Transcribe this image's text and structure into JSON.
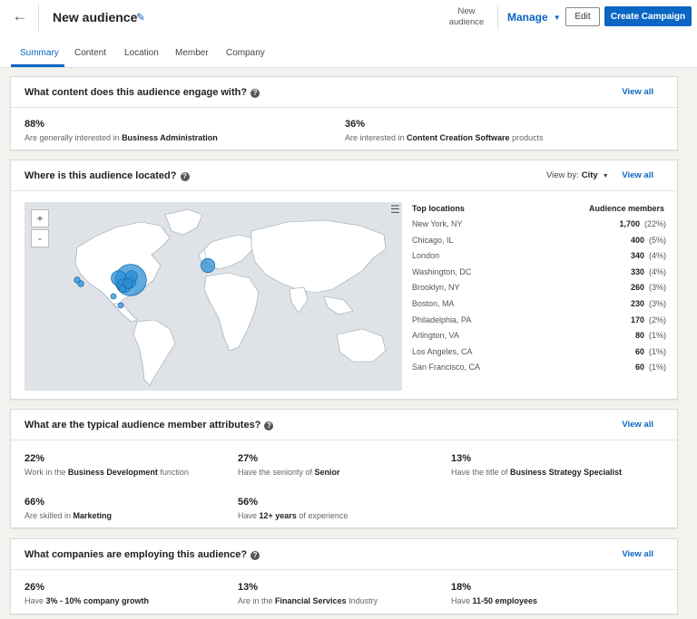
{
  "header": {
    "back_icon": "arrow-left-icon",
    "title": "New audience",
    "edit_icon": "pencil-icon",
    "name_line1": "New",
    "name_line2": "audience",
    "manage_label": "Manage",
    "edit_label": "Edit",
    "create_label": "Create Campaign"
  },
  "tabs": [
    {
      "label": "Summary",
      "active": true
    },
    {
      "label": "Content"
    },
    {
      "label": "Location"
    },
    {
      "label": "Member"
    },
    {
      "label": "Company"
    }
  ],
  "content_card": {
    "title": "What content does this audience engage with?",
    "view_all": "View all",
    "stats": [
      {
        "pct": "88%",
        "pre": "Are generally interested in ",
        "bold": "Business Administration",
        "post": ""
      },
      {
        "pct": "36%",
        "pre": "Are interested in ",
        "bold": "Content Creation Software",
        "post": " products"
      }
    ]
  },
  "location_card": {
    "title": "Where is this audience located?",
    "view_by_label": "View by:",
    "view_by_value": "City",
    "view_all": "View all",
    "zoom_in": "+",
    "zoom_out": "-",
    "menu_icon": "hamburger-menu-icon",
    "col_locations": "Top locations",
    "col_members": "Audience members",
    "rows": [
      {
        "city": "New York, NY",
        "count": "1,700",
        "pct": "(22%)"
      },
      {
        "city": "Chicago, IL",
        "count": "400",
        "pct": "(5%)"
      },
      {
        "city": "London",
        "count": "340",
        "pct": "(4%)"
      },
      {
        "city": "Washington, DC",
        "count": "330",
        "pct": "(4%)"
      },
      {
        "city": "Brooklyn, NY",
        "count": "260",
        "pct": "(3%)"
      },
      {
        "city": "Boston, MA",
        "count": "230",
        "pct": "(3%)"
      },
      {
        "city": "Philadelphia, PA",
        "count": "170",
        "pct": "(2%)"
      },
      {
        "city": "Arlington, VA",
        "count": "80",
        "pct": "(1%)"
      },
      {
        "city": "Los Angeles, CA",
        "count": "60",
        "pct": "(1%)"
      },
      {
        "city": "San Francisco, CA",
        "count": "60",
        "pct": "(1%)"
      }
    ]
  },
  "attributes_card": {
    "title": "What are the typical audience member attributes?",
    "view_all": "View all",
    "stats": [
      {
        "pct": "22%",
        "pre": "Work in the ",
        "bold": "Business Development",
        "post": " function"
      },
      {
        "pct": "27%",
        "pre": "Have the seniority of ",
        "bold": "Senior",
        "post": ""
      },
      {
        "pct": "13%",
        "pre": "Have the title of ",
        "bold": "Business Strategy Specialist",
        "post": ""
      },
      {
        "pct": "66%",
        "pre": "Are skilled in ",
        "bold": "Marketing",
        "post": ""
      },
      {
        "pct": "56%",
        "pre": "Have ",
        "bold": "12+ years",
        "post": " of experience"
      }
    ]
  },
  "companies_card": {
    "title": "What companies are employing this audience?",
    "view_all": "View all",
    "stats": [
      {
        "pct": "26%",
        "pre": "Have ",
        "bold": "3% - 10% company growth",
        "post": ""
      },
      {
        "pct": "13%",
        "pre": "Are in the ",
        "bold": "Financial Services",
        "post": " Industry"
      },
      {
        "pct": "18%",
        "pre": "Have ",
        "bold": "11-50 employees",
        "post": ""
      }
    ]
  },
  "colors": {
    "accent": "#0a66c2",
    "bubble": "#2b8fd6",
    "land": "#ffffff",
    "water": "#dfe3e8"
  }
}
